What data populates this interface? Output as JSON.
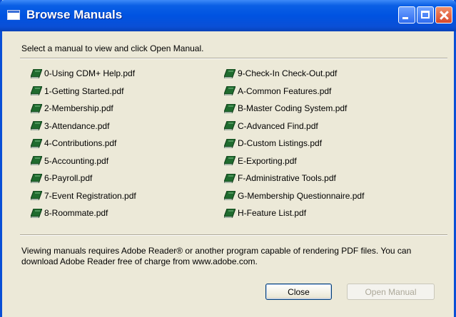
{
  "window": {
    "title": "Browse Manuals",
    "controls": [
      "minimize-icon",
      "maximize-icon",
      "close-icon"
    ]
  },
  "instruction": "Select a manual to view and click Open Manual.",
  "manuals": {
    "left": [
      "0-Using CDM+ Help.pdf",
      "1-Getting Started.pdf",
      "2-Membership.pdf",
      "3-Attendance.pdf",
      "4-Contributions.pdf",
      "5-Accounting.pdf",
      "6-Payroll.pdf",
      "7-Event Registration.pdf",
      "8-Roommate.pdf"
    ],
    "right": [
      "9-Check-In Check-Out.pdf",
      "A-Common Features.pdf",
      "B-Master Coding System.pdf",
      "C-Advanced Find.pdf",
      "D-Custom Listings.pdf",
      "E-Exporting.pdf",
      "F-Administrative Tools.pdf",
      "G-Membership Questionnaire.pdf",
      "H-Feature List.pdf"
    ],
    "icon": "book-icon",
    "icon_color": "#1f6b2e"
  },
  "notice": "Viewing manuals requires Adobe Reader® or another program capable of rendering PDF files.  You can download Adobe Reader free of charge from www.adobe.com.",
  "buttons": {
    "close_label": "Close",
    "open_label": "Open Manual",
    "open_enabled": false
  },
  "colors": {
    "titlebar": "#0053e1",
    "dialog_bg": "#ece9d8"
  }
}
